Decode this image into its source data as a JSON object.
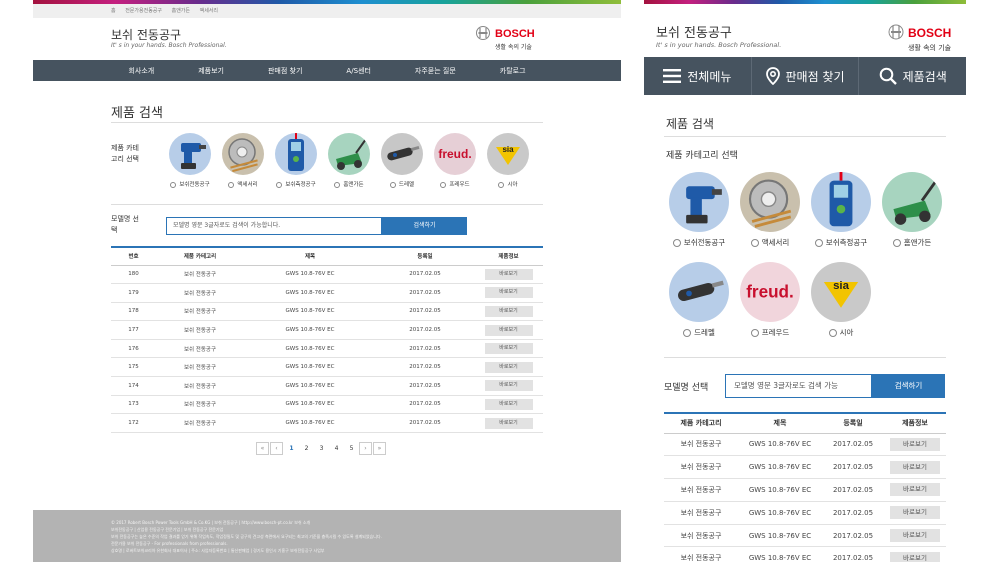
{
  "brand": {
    "logo_text": "BOSCH",
    "tagline": "생활 속의 기술",
    "accent": "#2b74b6",
    "nav_bg": "#46535f"
  },
  "desktop": {
    "breadcrumb": [
      "홈",
      "전문가용전동공구",
      "홈앤가든",
      "액세서리"
    ],
    "title": "보쉬 전동공구",
    "subtitle": "It' s in your hands. Bosch Professional.",
    "nav": [
      "회사소개",
      "제품보기",
      "판매점 찾기",
      "A/S센터",
      "자주묻는 질문",
      "카탈로그"
    ],
    "heading": "제품 검색",
    "category_label": "제품 카테고리 선택",
    "categories": [
      {
        "label": "보쉬전동공구",
        "icon": "cordless-drill-icon"
      },
      {
        "label": "액세서리",
        "icon": "saw-blade-accessory-icon"
      },
      {
        "label": "보쉬측정공구",
        "icon": "laser-measure-icon"
      },
      {
        "label": "홈앤가든",
        "icon": "lawn-mower-icon"
      },
      {
        "label": "드레멜",
        "icon": "dremel-rotary-tool-icon"
      },
      {
        "label": "프레우드",
        "icon": "freud-logo-icon"
      },
      {
        "label": "시아",
        "icon": "sia-logo-icon"
      }
    ],
    "model_label": "모델명 선택",
    "search_placeholder": "모델명 영문 3글자로도 검색이 가능합니다.",
    "search_button": "검색하기",
    "table_headers": [
      "번호",
      "제품 카테고리",
      "제목",
      "등록일",
      "제품정보"
    ],
    "rows": [
      {
        "no": "180",
        "cat": "보쉬 전동공구",
        "title": "GWS 10.8-76V EC",
        "date": "2017.02.05",
        "btn": "바로보기"
      },
      {
        "no": "179",
        "cat": "보쉬 전동공구",
        "title": "GWS 10.8-76V EC",
        "date": "2017.02.05",
        "btn": "바로보기"
      },
      {
        "no": "178",
        "cat": "보쉬 전동공구",
        "title": "GWS 10.8-76V EC",
        "date": "2017.02.05",
        "btn": "바로보기"
      },
      {
        "no": "177",
        "cat": "보쉬 전동공구",
        "title": "GWS 10.8-76V EC",
        "date": "2017.02.05",
        "btn": "바로보기"
      },
      {
        "no": "176",
        "cat": "보쉬 전동공구",
        "title": "GWS 10.8-76V EC",
        "date": "2017.02.05",
        "btn": "바로보기"
      },
      {
        "no": "175",
        "cat": "보쉬 전동공구",
        "title": "GWS 10.8-76V EC",
        "date": "2017.02.05",
        "btn": "바로보기"
      },
      {
        "no": "174",
        "cat": "보쉬 전동공구",
        "title": "GWS 10.8-76V EC",
        "date": "2017.02.05",
        "btn": "바로보기"
      },
      {
        "no": "173",
        "cat": "보쉬 전동공구",
        "title": "GWS 10.8-76V EC",
        "date": "2017.02.05",
        "btn": "바로보기"
      },
      {
        "no": "172",
        "cat": "보쉬 전동공구",
        "title": "GWS 10.8-76V EC",
        "date": "2017.02.05",
        "btn": "바로보기"
      }
    ],
    "pager": {
      "first": "«",
      "prev": "‹",
      "pages": [
        "1",
        "2",
        "3",
        "4",
        "5"
      ],
      "current": "1",
      "next": "›",
      "last": "»"
    },
    "footer": [
      "© 2017 Robert Bosch Power Tools GmbH & Co.KG | 보쉬 전동공구 | http://www.bosch-pt.co.kr 보쉬 소개",
      "보쉬전동공구 | 산업용 전동공구 전문기업 | 보쉬 전동공구 전문기업",
      "보쉬 전동공구는 높은 수준의 작업 결과를 얻기 위해 작업속도, 작업정밀도 및 공구의 견고성 측면에서 요구되는 최고의 기준을 충족시킬 수 있도록 설계되었습니다.",
      "전문가용 보쉬 전동공구 - For professionals from professionals.",
      "상호명 | 로버트보쉬코리아 유한회사 대표이사 | 주소: 사업자등록번호 | 통신판매업 | 경기도 용인시 기흥구 보쉬전동공구 사업부"
    ]
  },
  "mobile": {
    "title": "보쉬 전동공구",
    "subtitle": "It' s in your hands. Bosch Professional.",
    "nav": [
      {
        "label": "전체메뉴",
        "icon": "hamburger-menu-icon"
      },
      {
        "label": "판매점 찾기",
        "icon": "location-pin-icon"
      },
      {
        "label": "제품검색",
        "icon": "search-icon"
      }
    ],
    "heading": "제품 검색",
    "category_label": "제품 카테고리 선택",
    "categories": [
      "보쉬전동공구",
      "액세서리",
      "보쉬측정공구",
      "홈앤가든",
      "드레멜",
      "프레우드",
      "시아"
    ],
    "model_label": "모델명 선택",
    "search_placeholder": "모델명 영문 3글자로도 검색 가능",
    "search_button": "검색하기",
    "table_headers": [
      "제품 카테고리",
      "제목",
      "등록일",
      "제품정보"
    ],
    "rows": [
      {
        "cat": "보쉬 전동공구",
        "title": "GWS 10.8-76V EC",
        "date": "2017.02.05",
        "btn": "바로보기"
      },
      {
        "cat": "보쉬 전동공구",
        "title": "GWS 10.8-76V EC",
        "date": "2017.02.05",
        "btn": "바로보기"
      },
      {
        "cat": "보쉬 전동공구",
        "title": "GWS 10.8-76V EC",
        "date": "2017.02.05",
        "btn": "바로보기"
      },
      {
        "cat": "보쉬 전동공구",
        "title": "GWS 10.8-76V EC",
        "date": "2017.02.05",
        "btn": "바로보기"
      },
      {
        "cat": "보쉬 전동공구",
        "title": "GWS 10.8-76V EC",
        "date": "2017.02.05",
        "btn": "바로보기"
      },
      {
        "cat": "보쉬 전동공구",
        "title": "GWS 10.8-76V EC",
        "date": "2017.02.05",
        "btn": "바로보기"
      }
    ]
  }
}
